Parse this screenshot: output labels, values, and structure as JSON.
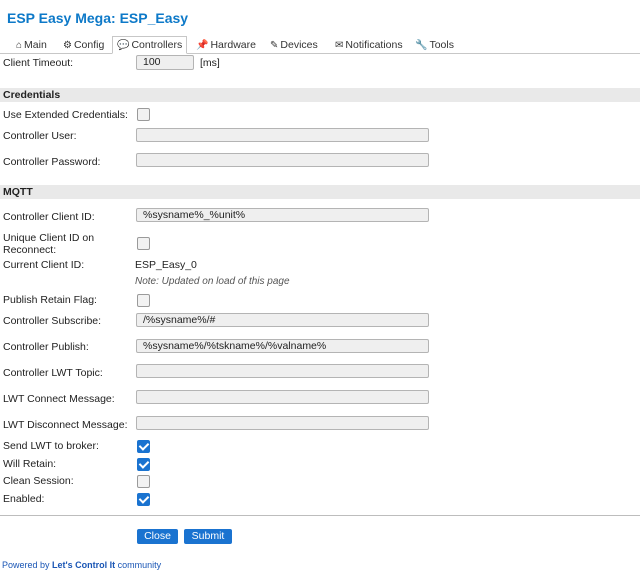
{
  "app": {
    "title": "ESP Easy Mega: ESP_Easy"
  },
  "tabs": [
    {
      "icon": "⌂",
      "label": "Main"
    },
    {
      "icon": "⚙",
      "label": "Config"
    },
    {
      "icon": "💬",
      "label": "Controllers"
    },
    {
      "icon": "📌",
      "label": "Hardware"
    },
    {
      "icon": "✎",
      "label": "Devices"
    },
    {
      "icon": "✉",
      "label": "Notifications"
    },
    {
      "icon": "🔧",
      "label": "Tools"
    }
  ],
  "client_timeout": {
    "label": "Client Timeout:",
    "value": "100",
    "unit": "[ms]"
  },
  "credentials": {
    "header": "Credentials",
    "use_extended_label": "Use Extended Credentials:",
    "use_extended_checked": false,
    "user_label": "Controller User:",
    "user_value": "",
    "password_label": "Controller Password:",
    "password_value": ""
  },
  "mqtt": {
    "header": "MQTT",
    "client_id_label": "Controller Client ID:",
    "client_id_value": "%sysname%_%unit%",
    "unique_id_label": "Unique Client ID on Reconnect:",
    "unique_id_checked": false,
    "current_id_label": "Current Client ID:",
    "current_id_value": "ESP_Easy_0",
    "current_id_note": "Note: Updated on load of this page",
    "retain_label": "Publish Retain Flag:",
    "retain_checked": false,
    "subscribe_label": "Controller Subscribe:",
    "subscribe_value": "/%sysname%/#",
    "publish_label": "Controller Publish:",
    "publish_value": "%sysname%/%tskname%/%valname%",
    "lwt_topic_label": "Controller LWT Topic:",
    "lwt_topic_value": "",
    "lwt_connect_label": "LWT Connect Message:",
    "lwt_connect_value": "",
    "lwt_disconnect_label": "LWT Disconnect Message:",
    "lwt_disconnect_value": "",
    "send_lwt_label": "Send LWT to broker:",
    "send_lwt_checked": true,
    "will_retain_label": "Will Retain:",
    "will_retain_checked": true,
    "clean_session_label": "Clean Session:",
    "clean_session_checked": false,
    "enabled_label": "Enabled:",
    "enabled_checked": true
  },
  "buttons": {
    "close": "Close",
    "submit": "Submit"
  },
  "footer": {
    "prefix": "Powered by ",
    "link": "Let's Control It",
    "suffix": " community"
  },
  "colors": {
    "accent": "#1a73d0",
    "title": "#0d79c8"
  }
}
